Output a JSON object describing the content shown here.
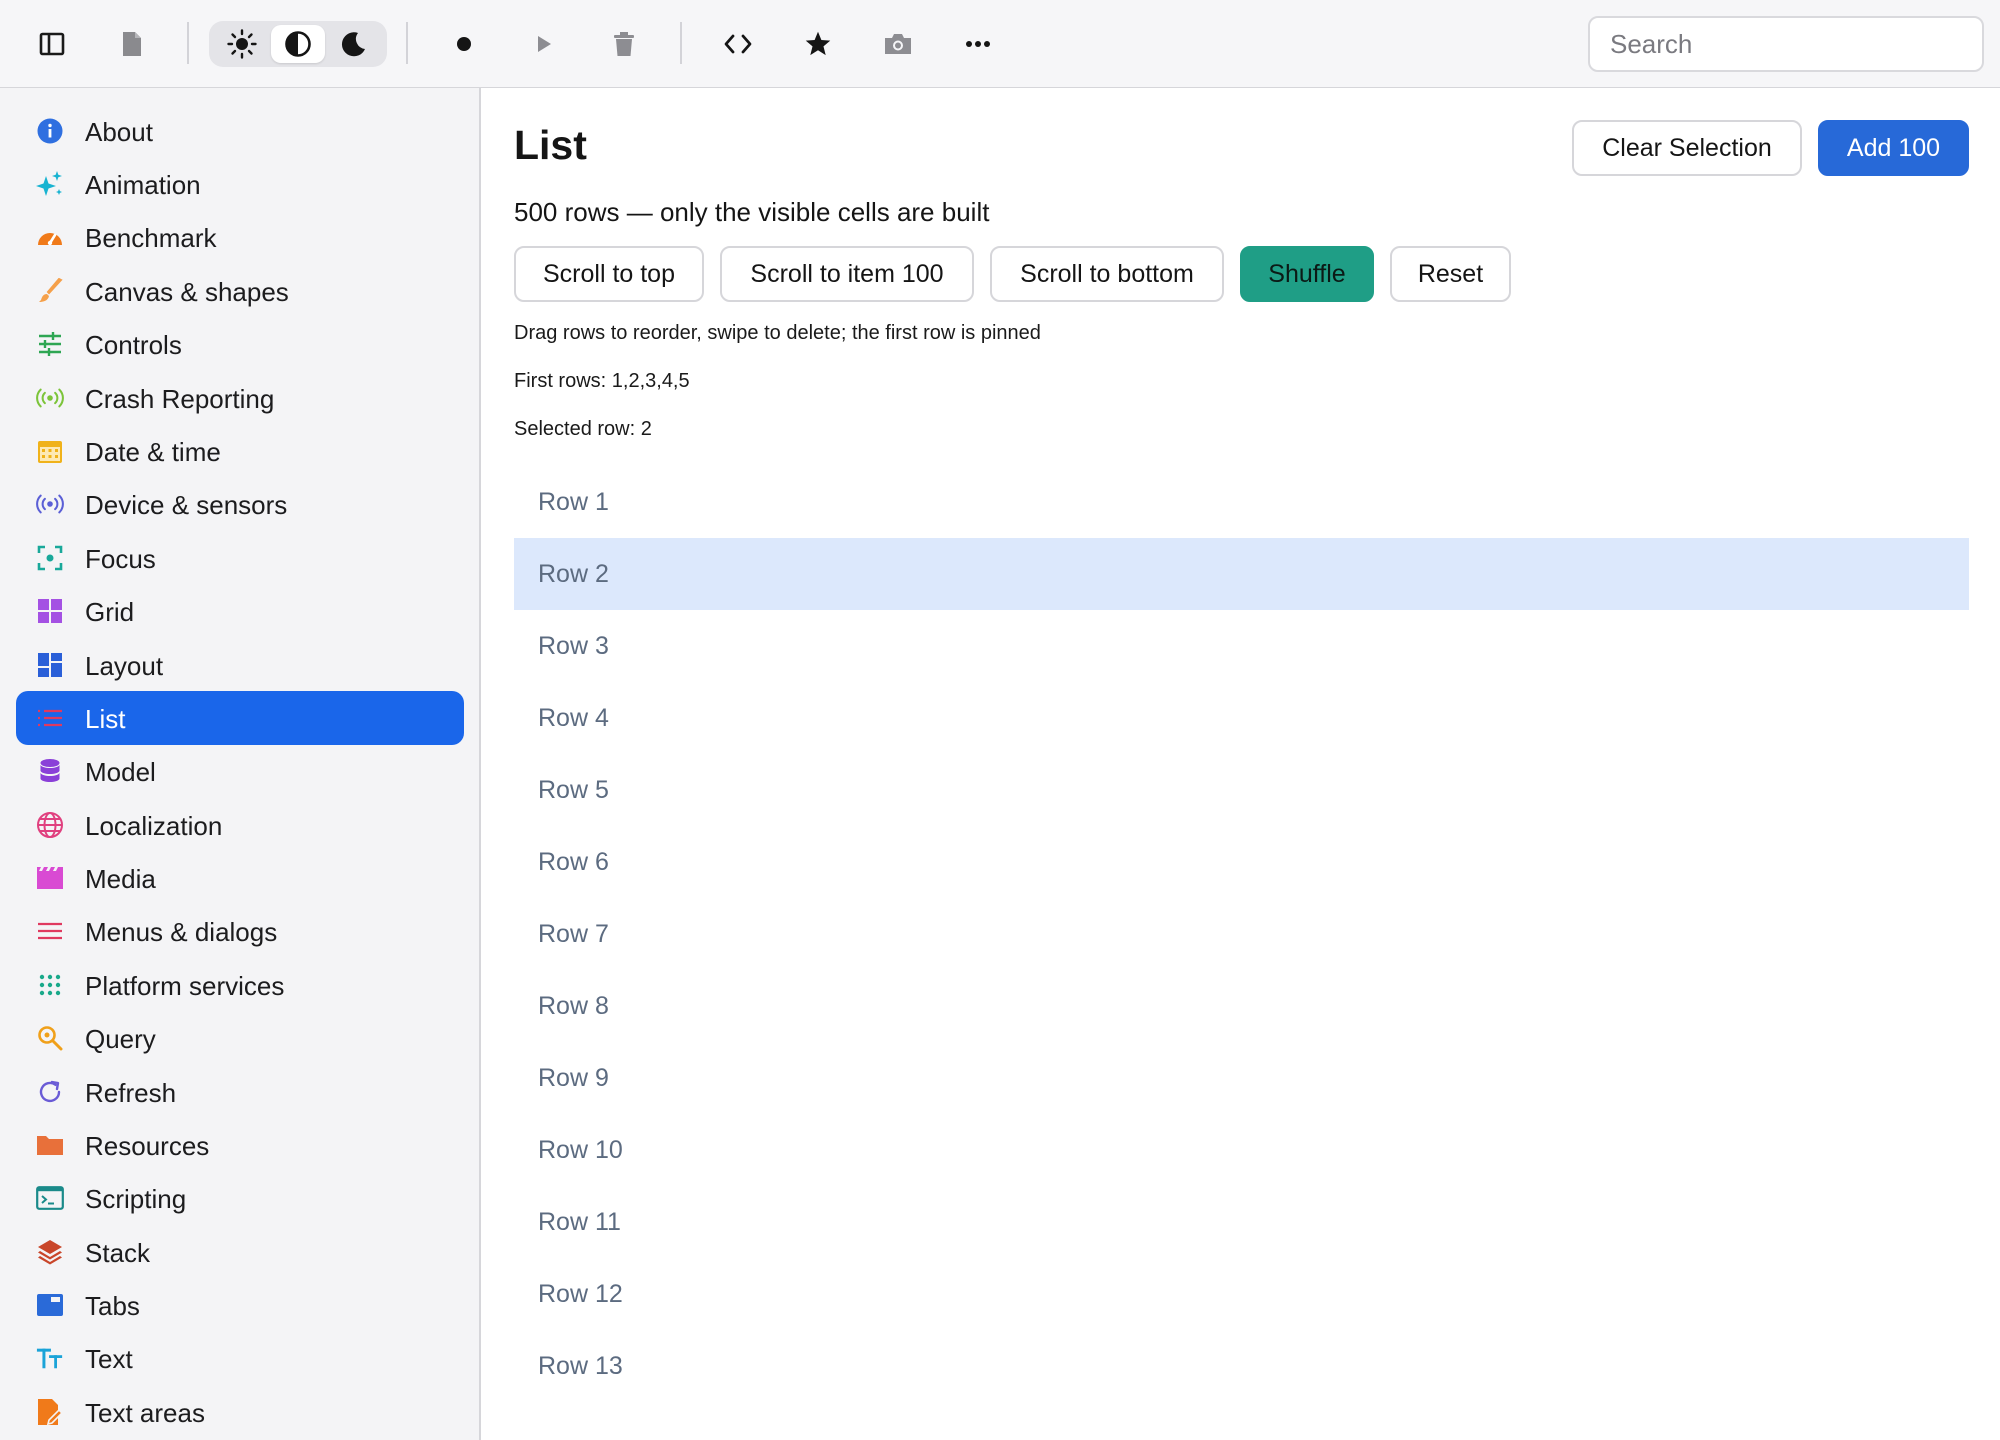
{
  "toolbar": {
    "search_placeholder": "Search",
    "theme_modes": [
      "light",
      "contrast",
      "dark"
    ],
    "active_theme": "contrast",
    "icons": [
      "sidebar-toggle-icon",
      "document-icon",
      "sun-icon",
      "contrast-icon",
      "moon-icon",
      "record-icon",
      "play-icon",
      "trash-icon",
      "code-icon",
      "star-icon",
      "camera-icon",
      "more-icon"
    ]
  },
  "sidebar": {
    "active": "List",
    "items": [
      {
        "label": "About",
        "icon": "info-icon",
        "color": "#2f6fe0"
      },
      {
        "label": "Animation",
        "icon": "sparkles-icon",
        "color": "#18b3d1"
      },
      {
        "label": "Benchmark",
        "icon": "gauge-icon",
        "color": "#f07a1a"
      },
      {
        "label": "Canvas & shapes",
        "icon": "brush-icon",
        "color": "#f5a04a"
      },
      {
        "label": "Controls",
        "icon": "sliders-icon",
        "color": "#2ea653"
      },
      {
        "label": "Crash Reporting",
        "icon": "broadcast-icon",
        "color": "#7cc43a"
      },
      {
        "label": "Date & time",
        "icon": "calendar-icon",
        "color": "#f0b21a"
      },
      {
        "label": "Device & sensors",
        "icon": "sensors-icon",
        "color": "#5b5fd6"
      },
      {
        "label": "Focus",
        "icon": "focus-icon",
        "color": "#19a89a"
      },
      {
        "label": "Grid",
        "icon": "grid-icon",
        "color": "#a451e3"
      },
      {
        "label": "Layout",
        "icon": "layout-icon",
        "color": "#2a5fd8"
      },
      {
        "label": "List",
        "icon": "list-icon",
        "color": "#e0395f"
      },
      {
        "label": "Model",
        "icon": "database-icon",
        "color": "#8a3fd8"
      },
      {
        "label": "Localization",
        "icon": "globe-icon",
        "color": "#e0407f"
      },
      {
        "label": "Media",
        "icon": "clapper-icon",
        "color": "#d94ad3"
      },
      {
        "label": "Menus & dialogs",
        "icon": "menu-icon",
        "color": "#e0395f"
      },
      {
        "label": "Platform services",
        "icon": "dots-grid-icon",
        "color": "#1aa98a"
      },
      {
        "label": "Query",
        "icon": "query-icon",
        "color": "#f0a01a"
      },
      {
        "label": "Refresh",
        "icon": "refresh-icon",
        "color": "#6a5bd6"
      },
      {
        "label": "Resources",
        "icon": "folder-icon",
        "color": "#e8703a"
      },
      {
        "label": "Scripting",
        "icon": "terminal-icon",
        "color": "#1a8a8a"
      },
      {
        "label": "Stack",
        "icon": "stack-icon",
        "color": "#c9462a"
      },
      {
        "label": "Tabs",
        "icon": "tabs-icon",
        "color": "#2a6ad8"
      },
      {
        "label": "Text",
        "icon": "text-icon",
        "color": "#1aa3d8"
      },
      {
        "label": "Text areas",
        "icon": "text-area-icon",
        "color": "#f07a1a"
      }
    ]
  },
  "main": {
    "title": "List",
    "clear_selection_label": "Clear Selection",
    "add_label": "Add 100",
    "subtitle": "500 rows — only the visible cells are built",
    "actions": [
      "Scroll to top",
      "Scroll to item 100",
      "Scroll to bottom",
      "Shuffle",
      "Reset"
    ],
    "hint": "Drag rows to reorder, swipe to delete; the first row is pinned",
    "first_rows": "First rows: 1,2,3,4,5",
    "selected_row_text": "Selected row: 2",
    "selected_row": 2,
    "rows": [
      "Row 1",
      "Row 2",
      "Row 3",
      "Row 4",
      "Row 5",
      "Row 6",
      "Row 7",
      "Row 8",
      "Row 9",
      "Row 10",
      "Row 11",
      "Row 12",
      "Row 13"
    ],
    "colors": {
      "accent": "#2769d8",
      "shuffle": "#1f9e86",
      "selected_row_bg": "#dce8fc",
      "sidebar_active": "#1a66ea"
    }
  }
}
